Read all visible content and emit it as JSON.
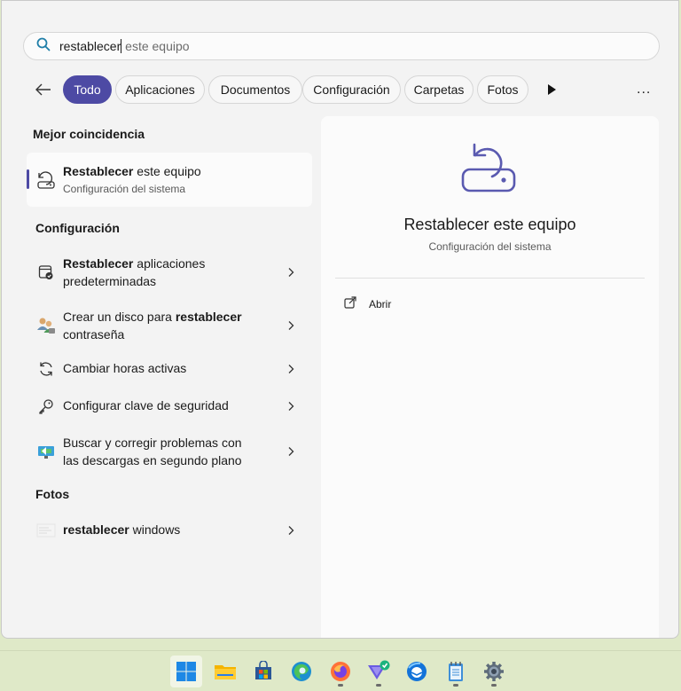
{
  "search": {
    "typed": "restablecer",
    "hint": " este equipo"
  },
  "filters": {
    "items": [
      "Todo",
      "Aplicaciones",
      "Documentos",
      "Configuración",
      "Carpetas",
      "Fotos"
    ],
    "active": "Todo",
    "more": "..."
  },
  "best_match": {
    "header": "Mejor coincidencia",
    "title_bold": "Restablecer",
    "title_rest": " este equipo",
    "subtitle": "Configuración del sistema"
  },
  "settings": {
    "header": "Configuración",
    "items": [
      {
        "bold": "Restablecer",
        "line1_rest": " aplicaciones",
        "line2": "predeterminadas",
        "icon": "default-apps-icon"
      },
      {
        "line1_pre": "Crear un disco para ",
        "bold": "restablecer",
        "line2": "contraseña",
        "icon": "users-icon"
      },
      {
        "line1": "Cambiar horas activas",
        "icon": "refresh-icon"
      },
      {
        "line1": "Configurar clave de seguridad",
        "icon": "key-icon"
      },
      {
        "line1": "Buscar y corregir problemas con",
        "line2": "las descargas en segundo plano",
        "icon": "troubleshoot-icon"
      }
    ]
  },
  "photos": {
    "header": "Fotos",
    "items": [
      {
        "bold": "restablecer",
        "rest": " windows",
        "icon": "photo-thumbnail-icon"
      }
    ]
  },
  "detail": {
    "title": "Restablecer este equipo",
    "subtitle": "Configuración del sistema",
    "open_label": "Abrir"
  },
  "taskbar": {
    "apps": [
      "start",
      "file-explorer",
      "store",
      "edge",
      "firefox",
      "vpn",
      "thunderbird",
      "notepad",
      "settings"
    ]
  },
  "colors": {
    "accent": "#4d4aa4",
    "taskbar": "#dfe9c8"
  }
}
